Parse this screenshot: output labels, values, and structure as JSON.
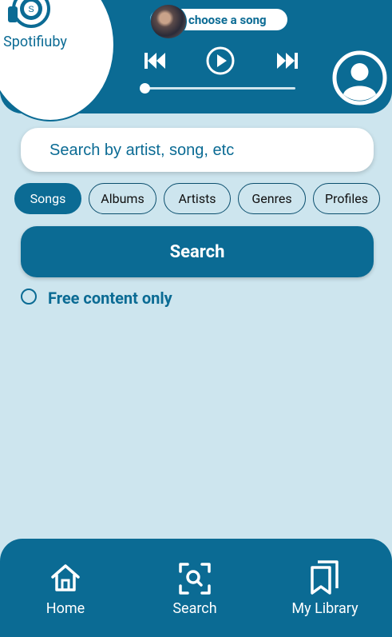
{
  "app": {
    "name": "Spotifiuby"
  },
  "player": {
    "now_playing_label": "choose a song",
    "progress": 0
  },
  "search": {
    "placeholder": "Search by artist, song, etc",
    "button_label": "Search"
  },
  "filters": [
    {
      "label": "Songs",
      "active": true
    },
    {
      "label": "Albums",
      "active": false
    },
    {
      "label": "Artists",
      "active": false
    },
    {
      "label": "Genres",
      "active": false
    },
    {
      "label": "Profiles",
      "active": false
    }
  ],
  "free_content": {
    "label": "Free content only",
    "checked": false
  },
  "nav": [
    {
      "label": "Home",
      "icon": "home-icon"
    },
    {
      "label": "Search",
      "icon": "search-scan-icon"
    },
    {
      "label": "My Library",
      "icon": "library-icon"
    }
  ],
  "colors": {
    "primary": "#0b6b94",
    "background": "#cde5ee"
  }
}
